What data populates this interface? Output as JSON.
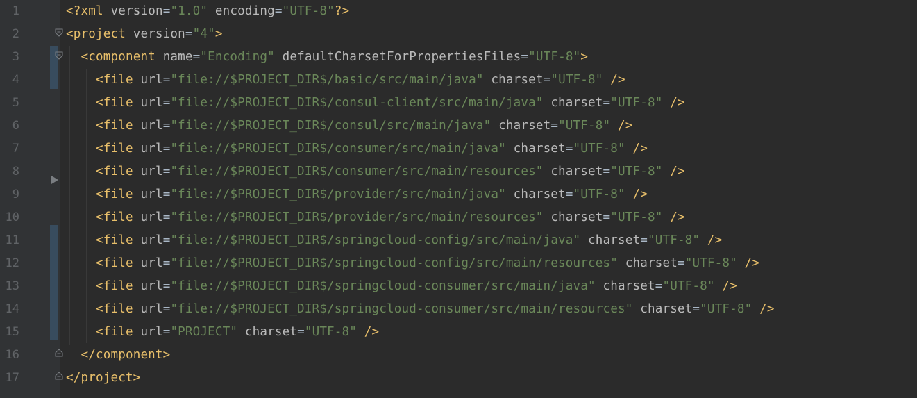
{
  "editor": {
    "file_language": "xml",
    "lines": [
      {
        "n": "1",
        "parts": [
          [
            "punct",
            "<?"
          ],
          [
            "tag",
            "xml"
          ],
          [
            "text",
            " "
          ],
          [
            "attr",
            "version"
          ],
          [
            "text",
            "="
          ],
          [
            "val",
            "\"1.0\""
          ],
          [
            "text",
            " "
          ],
          [
            "attr",
            "encoding"
          ],
          [
            "text",
            "="
          ],
          [
            "val",
            "\"UTF-8\""
          ],
          [
            "punct",
            "?>"
          ]
        ]
      },
      {
        "n": "2",
        "parts": [
          [
            "tag",
            "<project"
          ],
          [
            "text",
            " "
          ],
          [
            "attr",
            "version"
          ],
          [
            "text",
            "="
          ],
          [
            "val",
            "\"4\""
          ],
          [
            "tag",
            ">"
          ]
        ]
      },
      {
        "n": "3",
        "parts": [
          [
            "text",
            "  "
          ],
          [
            "tag",
            "<component"
          ],
          [
            "text",
            " "
          ],
          [
            "attr",
            "name"
          ],
          [
            "text",
            "="
          ],
          [
            "val",
            "\"Encoding\""
          ],
          [
            "text",
            " "
          ],
          [
            "attr",
            "defaultCharsetForPropertiesFiles"
          ],
          [
            "text",
            "="
          ],
          [
            "val",
            "\"UTF-8\""
          ],
          [
            "tag",
            ">"
          ]
        ]
      },
      {
        "n": "4",
        "parts": [
          [
            "text",
            "    "
          ],
          [
            "tag",
            "<file"
          ],
          [
            "text",
            " "
          ],
          [
            "attr",
            "url"
          ],
          [
            "text",
            "="
          ],
          [
            "val",
            "\"file://$PROJECT_DIR$/basic/src/main/java\""
          ],
          [
            "text",
            " "
          ],
          [
            "attr",
            "charset"
          ],
          [
            "text",
            "="
          ],
          [
            "val",
            "\"UTF-8\""
          ],
          [
            "text",
            " "
          ],
          [
            "tag",
            "/>"
          ]
        ]
      },
      {
        "n": "5",
        "parts": [
          [
            "text",
            "    "
          ],
          [
            "tag",
            "<file"
          ],
          [
            "text",
            " "
          ],
          [
            "attr",
            "url"
          ],
          [
            "text",
            "="
          ],
          [
            "val",
            "\"file://$PROJECT_DIR$/consul-client/src/main/java\""
          ],
          [
            "text",
            " "
          ],
          [
            "attr",
            "charset"
          ],
          [
            "text",
            "="
          ],
          [
            "val",
            "\"UTF-8\""
          ],
          [
            "text",
            " "
          ],
          [
            "tag",
            "/>"
          ]
        ]
      },
      {
        "n": "6",
        "parts": [
          [
            "text",
            "    "
          ],
          [
            "tag",
            "<file"
          ],
          [
            "text",
            " "
          ],
          [
            "attr",
            "url"
          ],
          [
            "text",
            "="
          ],
          [
            "val",
            "\"file://$PROJECT_DIR$/consul/src/main/java\""
          ],
          [
            "text",
            " "
          ],
          [
            "attr",
            "charset"
          ],
          [
            "text",
            "="
          ],
          [
            "val",
            "\"UTF-8\""
          ],
          [
            "text",
            " "
          ],
          [
            "tag",
            "/>"
          ]
        ]
      },
      {
        "n": "7",
        "parts": [
          [
            "text",
            "    "
          ],
          [
            "tag",
            "<file"
          ],
          [
            "text",
            " "
          ],
          [
            "attr",
            "url"
          ],
          [
            "text",
            "="
          ],
          [
            "val",
            "\"file://$PROJECT_DIR$/consumer/src/main/java\""
          ],
          [
            "text",
            " "
          ],
          [
            "attr",
            "charset"
          ],
          [
            "text",
            "="
          ],
          [
            "val",
            "\"UTF-8\""
          ],
          [
            "text",
            " "
          ],
          [
            "tag",
            "/>"
          ]
        ]
      },
      {
        "n": "8",
        "parts": [
          [
            "text",
            "    "
          ],
          [
            "tag",
            "<file"
          ],
          [
            "text",
            " "
          ],
          [
            "attr",
            "url"
          ],
          [
            "text",
            "="
          ],
          [
            "val",
            "\"file://$PROJECT_DIR$/consumer/src/main/resources\""
          ],
          [
            "text",
            " "
          ],
          [
            "attr",
            "charset"
          ],
          [
            "text",
            "="
          ],
          [
            "val",
            "\"UTF-8\""
          ],
          [
            "text",
            " "
          ],
          [
            "tag",
            "/>"
          ]
        ]
      },
      {
        "n": "9",
        "parts": [
          [
            "text",
            "    "
          ],
          [
            "tag",
            "<file"
          ],
          [
            "text",
            " "
          ],
          [
            "attr",
            "url"
          ],
          [
            "text",
            "="
          ],
          [
            "val",
            "\"file://$PROJECT_DIR$/provider/src/main/java\""
          ],
          [
            "text",
            " "
          ],
          [
            "attr",
            "charset"
          ],
          [
            "text",
            "="
          ],
          [
            "val",
            "\"UTF-8\""
          ],
          [
            "text",
            " "
          ],
          [
            "tag",
            "/>"
          ]
        ]
      },
      {
        "n": "10",
        "parts": [
          [
            "text",
            "    "
          ],
          [
            "tag",
            "<file"
          ],
          [
            "text",
            " "
          ],
          [
            "attr",
            "url"
          ],
          [
            "text",
            "="
          ],
          [
            "val",
            "\"file://$PROJECT_DIR$/provider/src/main/resources\""
          ],
          [
            "text",
            " "
          ],
          [
            "attr",
            "charset"
          ],
          [
            "text",
            "="
          ],
          [
            "val",
            "\"UTF-8\""
          ],
          [
            "text",
            " "
          ],
          [
            "tag",
            "/>"
          ]
        ]
      },
      {
        "n": "11",
        "parts": [
          [
            "text",
            "    "
          ],
          [
            "tag",
            "<file"
          ],
          [
            "text",
            " "
          ],
          [
            "attr",
            "url"
          ],
          [
            "text",
            "="
          ],
          [
            "val",
            "\"file://$PROJECT_DIR$/springcloud-config/src/main/java\""
          ],
          [
            "text",
            " "
          ],
          [
            "attr",
            "charset"
          ],
          [
            "text",
            "="
          ],
          [
            "val",
            "\"UTF-8\""
          ],
          [
            "text",
            " "
          ],
          [
            "tag",
            "/>"
          ]
        ]
      },
      {
        "n": "12",
        "parts": [
          [
            "text",
            "    "
          ],
          [
            "tag",
            "<file"
          ],
          [
            "text",
            " "
          ],
          [
            "attr",
            "url"
          ],
          [
            "text",
            "="
          ],
          [
            "val",
            "\"file://$PROJECT_DIR$/springcloud-config/src/main/resources\""
          ],
          [
            "text",
            " "
          ],
          [
            "attr",
            "charset"
          ],
          [
            "text",
            "="
          ],
          [
            "val",
            "\"UTF-8\""
          ],
          [
            "text",
            " "
          ],
          [
            "tag",
            "/>"
          ]
        ]
      },
      {
        "n": "13",
        "parts": [
          [
            "text",
            "    "
          ],
          [
            "tag",
            "<file"
          ],
          [
            "text",
            " "
          ],
          [
            "attr",
            "url"
          ],
          [
            "text",
            "="
          ],
          [
            "val",
            "\"file://$PROJECT_DIR$/springcloud-consumer/src/main/java\""
          ],
          [
            "text",
            " "
          ],
          [
            "attr",
            "charset"
          ],
          [
            "text",
            "="
          ],
          [
            "val",
            "\"UTF-8\""
          ],
          [
            "text",
            " "
          ],
          [
            "tag",
            "/>"
          ]
        ]
      },
      {
        "n": "14",
        "parts": [
          [
            "text",
            "    "
          ],
          [
            "tag",
            "<file"
          ],
          [
            "text",
            " "
          ],
          [
            "attr",
            "url"
          ],
          [
            "text",
            "="
          ],
          [
            "val",
            "\"file://$PROJECT_DIR$/springcloud-consumer/src/main/resources\""
          ],
          [
            "text",
            " "
          ],
          [
            "attr",
            "charset"
          ],
          [
            "text",
            "="
          ],
          [
            "val",
            "\"UTF-8\""
          ],
          [
            "text",
            " "
          ],
          [
            "tag",
            "/>"
          ]
        ]
      },
      {
        "n": "15",
        "parts": [
          [
            "text",
            "    "
          ],
          [
            "tag",
            "<file"
          ],
          [
            "text",
            " "
          ],
          [
            "attr",
            "url"
          ],
          [
            "text",
            "="
          ],
          [
            "val",
            "\"PROJECT\""
          ],
          [
            "text",
            " "
          ],
          [
            "attr",
            "charset"
          ],
          [
            "text",
            "="
          ],
          [
            "val",
            "\"UTF-8\""
          ],
          [
            "text",
            " "
          ],
          [
            "tag",
            "/>"
          ]
        ]
      },
      {
        "n": "16",
        "parts": [
          [
            "text",
            "  "
          ],
          [
            "tag",
            "</component>"
          ]
        ]
      },
      {
        "n": "17",
        "parts": [
          [
            "tag",
            "</project>"
          ]
        ]
      }
    ]
  },
  "colors": {
    "background": "#2b2b2b",
    "gutter": "#313335",
    "tag": "#e8bf6a",
    "attribute": "#bababa",
    "value": "#6a8759",
    "text": "#a9b7c6",
    "line_number": "#606366",
    "change_marker": "#384c5e"
  },
  "icons": {
    "fold_open": "fold-open-icon",
    "fold_close": "fold-close-icon",
    "gutter_marker": "triangle-marker-icon"
  }
}
